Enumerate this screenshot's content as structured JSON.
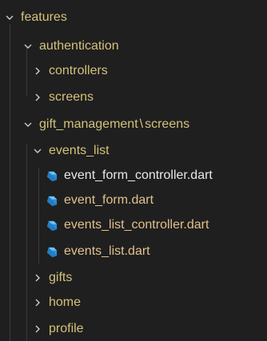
{
  "explorer": {
    "colors": {
      "folder_text": "#d3c27a",
      "file_text": "#e2c08d",
      "chevron": "#cccccc",
      "dart_icon": "#4aa3df",
      "background": "#1f1f1f"
    },
    "items": [
      {
        "label": "features",
        "type": "folder",
        "expanded": true,
        "depth": 0
      },
      {
        "label": "authentication",
        "type": "folder",
        "expanded": true,
        "depth": 1
      },
      {
        "label": "controllers",
        "type": "folder",
        "expanded": false,
        "depth": 2
      },
      {
        "label": "screens",
        "type": "folder",
        "expanded": false,
        "depth": 2
      },
      {
        "label": "gift_management",
        "label_sep": "\\",
        "label_tail": "screens",
        "type": "folder",
        "expanded": true,
        "depth": 1
      },
      {
        "label": "events_list",
        "type": "folder",
        "expanded": true,
        "depth": 2
      },
      {
        "label": "event_form_controller.dart",
        "type": "file",
        "icon": "dart-icon",
        "depth": 3
      },
      {
        "label": "event_form.dart",
        "type": "file",
        "icon": "dart-icon",
        "depth": 3
      },
      {
        "label": "events_list_controller.dart",
        "type": "file",
        "icon": "dart-icon",
        "depth": 3
      },
      {
        "label": "events_list.dart",
        "type": "file",
        "icon": "dart-icon",
        "depth": 3
      },
      {
        "label": "gifts",
        "type": "folder",
        "expanded": false,
        "depth": 2
      },
      {
        "label": "home",
        "type": "folder",
        "expanded": false,
        "depth": 2
      },
      {
        "label": "profile",
        "type": "folder",
        "expanded": false,
        "depth": 2
      }
    ]
  }
}
